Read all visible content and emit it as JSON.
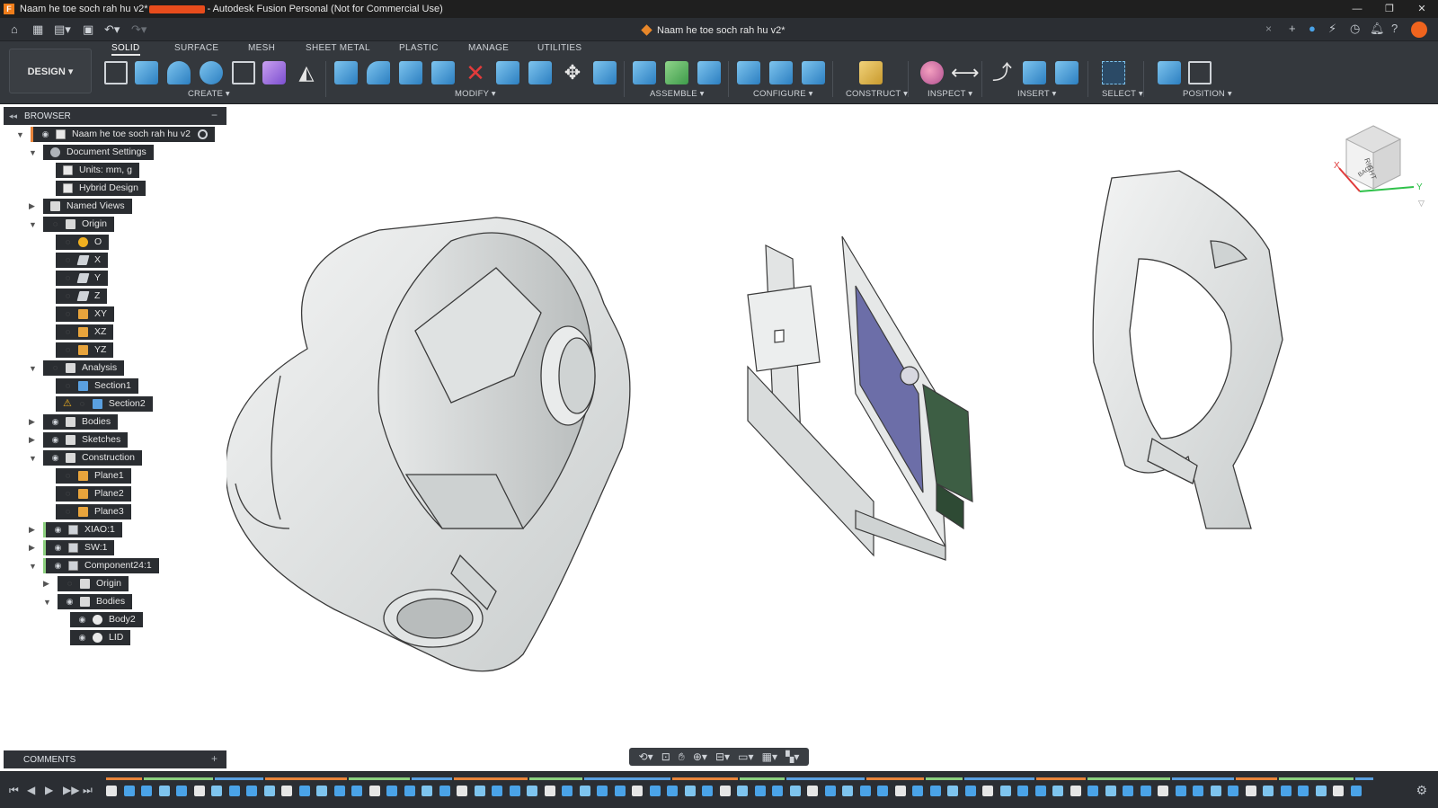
{
  "window": {
    "title_prefix": "Naam he toe soch rah hu v2*",
    "title_suffix": "- Autodesk Fusion Personal (Not for Commercial Use)",
    "app_icon": "F",
    "controls": [
      "—",
      "❐",
      "✕"
    ]
  },
  "document_tab": {
    "label": "Naam he toe soch rah hu v2*",
    "close": "×"
  },
  "workspace": {
    "label": "DESIGN ▾"
  },
  "ribbon_tabs": [
    {
      "label": "SOLID",
      "active": true
    },
    {
      "label": "SURFACE"
    },
    {
      "label": "MESH"
    },
    {
      "label": "SHEET METAL"
    },
    {
      "label": "PLASTIC"
    },
    {
      "label": "MANAGE"
    },
    {
      "label": "UTILITIES"
    }
  ],
  "ribbon_groups": [
    {
      "label": "CREATE ▾"
    },
    {
      "label": "MODIFY ▾"
    },
    {
      "label": "ASSEMBLE ▾"
    },
    {
      "label": "CONFIGURE ▾"
    },
    {
      "label": "CONSTRUCT ▾"
    },
    {
      "label": "INSPECT ▾"
    },
    {
      "label": "INSERT ▾"
    },
    {
      "label": "SELECT ▾"
    },
    {
      "label": "POSITION ▾"
    }
  ],
  "browser": {
    "title": "BROWSER",
    "pin": "◂◂",
    "collapse": "−",
    "root": "Naam he toe soch rah hu v2",
    "items": [
      {
        "label": "Document Settings"
      },
      {
        "label": "Units: mm, g"
      },
      {
        "label": "Hybrid Design"
      },
      {
        "label": "Named Views"
      },
      {
        "label": "Origin"
      },
      {
        "label": "O"
      },
      {
        "label": "X"
      },
      {
        "label": "Y"
      },
      {
        "label": "Z"
      },
      {
        "label": "XY"
      },
      {
        "label": "XZ"
      },
      {
        "label": "YZ"
      },
      {
        "label": "Analysis"
      },
      {
        "label": "Section1"
      },
      {
        "label": "Section2"
      },
      {
        "label": "Bodies"
      },
      {
        "label": "Sketches"
      },
      {
        "label": "Construction"
      },
      {
        "label": "Plane1"
      },
      {
        "label": "Plane2"
      },
      {
        "label": "Plane3"
      },
      {
        "label": "XIAO:1"
      },
      {
        "label": "SW:1"
      },
      {
        "label": "Component24:1"
      },
      {
        "label": "Origin"
      },
      {
        "label": "Bodies"
      },
      {
        "label": "Body2"
      },
      {
        "label": "LID"
      }
    ]
  },
  "comments": {
    "title": "COMMENTS",
    "add": "+"
  },
  "viewcube": {
    "face_right": "RIGHT",
    "face_back": "BACK",
    "axis_x": "X",
    "axis_y": "Y"
  },
  "colors": {
    "accent": "#2c7fc1",
    "warning": "#f0b020",
    "timeline_orange": "#e8843a",
    "timeline_green": "#8ccf7e",
    "timeline_blue": "#5aa0e0"
  }
}
